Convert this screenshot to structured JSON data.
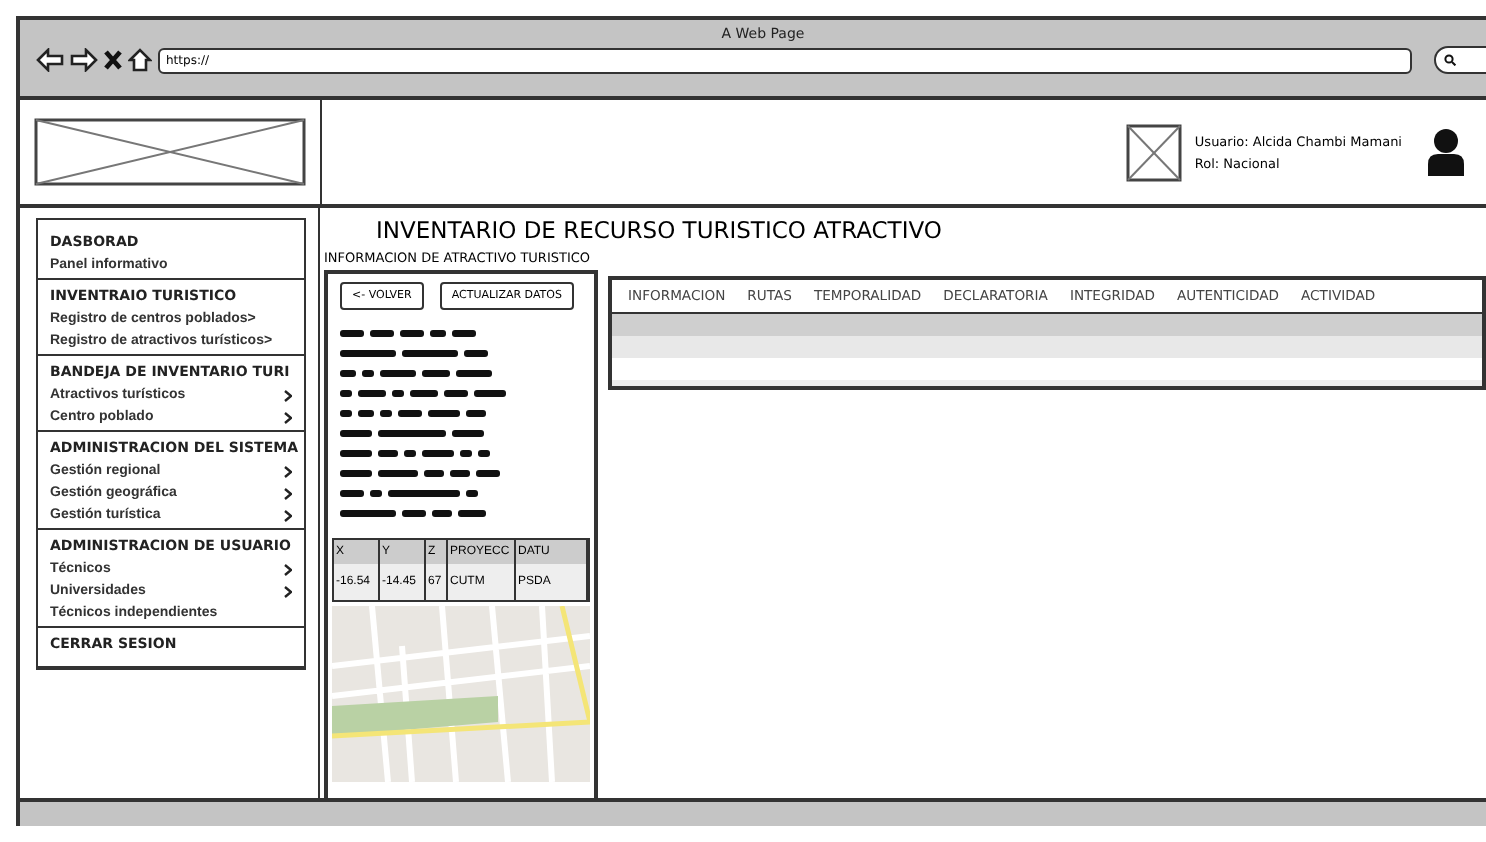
{
  "window": {
    "title": "A Web Page",
    "url": "https://"
  },
  "header": {
    "user": "Usuario: Alcida Chambi Mamani",
    "role": "Rol: Nacional"
  },
  "sidebar": [
    {
      "title": "DASBORAD",
      "items": [
        {
          "label": "Panel informativo",
          "submenu": false
        }
      ]
    },
    {
      "title": "INVENTRAIO TURISTICO",
      "items": [
        {
          "label": "Registro de centros poblados>",
          "submenu": false
        },
        {
          "label": "Registro de atractivos turísticos>",
          "submenu": false
        }
      ]
    },
    {
      "title": "BANDEJA DE INVENTARIO TURI",
      "items": [
        {
          "label": "Atractivos turísticos",
          "submenu": true
        },
        {
          "label": "Centro poblado",
          "submenu": true
        }
      ]
    },
    {
      "title": "ADMINISTRACION DEL SISTEMA",
      "items": [
        {
          "label": "Gestión regional",
          "submenu": true
        },
        {
          "label": "Gestión geográfica",
          "submenu": true
        },
        {
          "label": "Gestión turística",
          "submenu": true
        }
      ]
    },
    {
      "title": "ADMINISTRACION DE USUARIO",
      "items": [
        {
          "label": "Técnicos",
          "submenu": true
        },
        {
          "label": "Universidades",
          "submenu": true
        },
        {
          "label": "Técnicos independientes",
          "submenu": false
        }
      ]
    },
    {
      "title": "CERRAR SESION"
    }
  ],
  "page": {
    "title": "INVENTARIO DE RECURSO TURISTICO ATRACTIVO",
    "subtitle": "INFORMACION DE ATRACTIVO TURISTICO"
  },
  "buttons": [
    "<- VOLVER",
    "ACTUALIZAR DATOS"
  ],
  "coordinates": {
    "columns": [
      "X",
      "Y",
      "Z",
      "PROYECC",
      "DATU"
    ],
    "row": [
      "-16.54",
      "-14.45",
      "67",
      "CUTM",
      "PSDA"
    ]
  },
  "tabs": [
    {
      "label": "INFORMACION",
      "selected": false
    },
    {
      "label": "RUTAS",
      "selected": false
    },
    {
      "label": "TEMPORALIDAD",
      "selected": false
    },
    {
      "label": "DECLARATORIA",
      "selected": false
    },
    {
      "label": "INTEGRIDAD",
      "selected": false
    },
    {
      "label": "AUTENTICIDAD",
      "selected": false
    },
    {
      "label": "ACTIVIDAD",
      "selected": false
    }
  ]
}
